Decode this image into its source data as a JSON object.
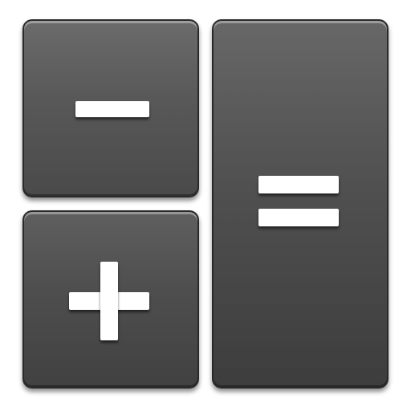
{
  "icon": {
    "colors": {
      "key_light": "#6b6b6b",
      "key_dark": "#414141",
      "glyph": "#ffffff",
      "border": "#2a2a2a"
    },
    "keys": [
      {
        "symbol": "minus-icon"
      },
      {
        "symbol": "plus-icon"
      },
      {
        "symbol": "equals-icon"
      }
    ]
  }
}
